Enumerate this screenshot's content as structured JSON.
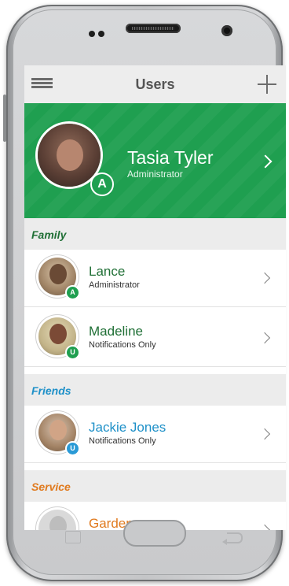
{
  "app_bar": {
    "title": "Users",
    "menu_icon": "menu-icon",
    "add_icon": "add-icon"
  },
  "current_user": {
    "name": "Tasia Tyler",
    "role": "Administrator",
    "badge": "A"
  },
  "sections": [
    {
      "title": "Family",
      "color": "#1f7f3f",
      "users": [
        {
          "name": "Lance",
          "role": "Administrator",
          "badge": "A",
          "badge_color": "#1f9f50",
          "name_color": "#1f6f35"
        },
        {
          "name": "Madeline",
          "role": "Notifications Only",
          "badge": "U",
          "badge_color": "#1f9f50",
          "name_color": "#1f6f35"
        }
      ]
    },
    {
      "title": "Friends",
      "color": "#1e90c8",
      "users": [
        {
          "name": "Jackie Jones",
          "role": "Notifications Only",
          "badge": "U",
          "badge_color": "#2a9ad6",
          "name_color": "#1e90c8"
        }
      ]
    },
    {
      "title": "Service",
      "color": "#e07a1e",
      "users": [
        {
          "name": "Gardener",
          "role": "",
          "badge": "",
          "badge_color": "#e07a1e",
          "name_color": "#e07a1e"
        }
      ]
    }
  ],
  "colors": {
    "accent_green": "#1f9f50",
    "header_bg": "#ededed",
    "section_bg": "#ececec"
  }
}
